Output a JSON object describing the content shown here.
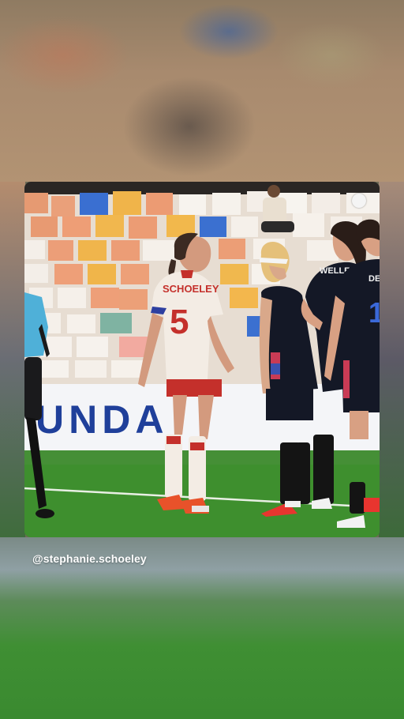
{
  "post": {
    "username": "@stephanie.schoeley",
    "board_text": "UNDA",
    "players": {
      "main_player_name": "SCHOELEY",
      "main_player_number": "5",
      "opponent_name_1": "WELLE",
      "opponent_name_2": "DE",
      "opponent_number_2": "1"
    }
  },
  "colors": {
    "pitch": "#3e8f2e",
    "canada_kit": "#f3ece4",
    "canada_red": "#c4302b",
    "usa_navy": "#141826",
    "referee_blue": "#4fb0d8"
  },
  "icons": [
    "more-options-dot-icon"
  ]
}
